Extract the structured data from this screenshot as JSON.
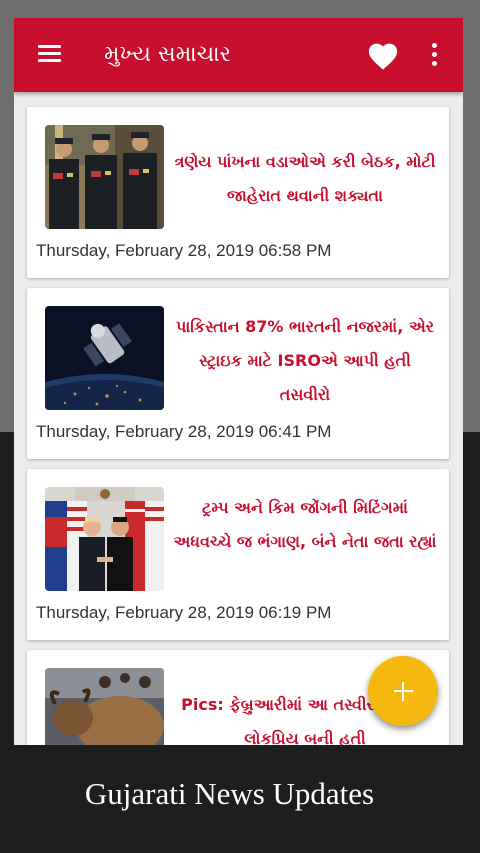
{
  "app": {
    "title": "મુખ્ય સમાચાર",
    "primary_color": "#c8102e",
    "fab_color": "#f6b80f"
  },
  "toolbar": {
    "menu_icon": "hamburger-menu-icon",
    "favorite_icon": "heart-icon",
    "overflow_icon": "more-vertical-icon"
  },
  "news": [
    {
      "headline": "ત્રણેય પાંખના વડાઓએ કરી બેઠક, મોટી જાહેરાત થવાની શક્યતા",
      "date": "Thursday, February 28, 2019 06:58 PM",
      "image": "military-chiefs-photo"
    },
    {
      "headline": "પાકિસ્તાન 87% ભારતની નજરમાં, એર સ્ટ્રાઇક માટે ISROએ આપી હતી તસવીરો",
      "date": "Thursday, February 28, 2019 06:41 PM",
      "image": "satellite-over-earth-photo"
    },
    {
      "headline": "ટ્રમ્પ અને કિમ જોંગની મિટિંગમાં અધવચ્ચે જ ભંગાણ, બંને નેતા જતા રહ્યાં",
      "date": "Thursday, February 28, 2019 06:19 PM",
      "image": "trump-kim-summit-photo"
    },
    {
      "headline": "Pics: ફેબ્રુઆરીમાં આ તસ્વીરો વિશ્વમાં લોકપ્રિય બની હતી",
      "date": "",
      "image": "bull-statue-photo"
    }
  ],
  "fab": {
    "icon": "plus-icon"
  },
  "caption": "Gujarati News Updates"
}
